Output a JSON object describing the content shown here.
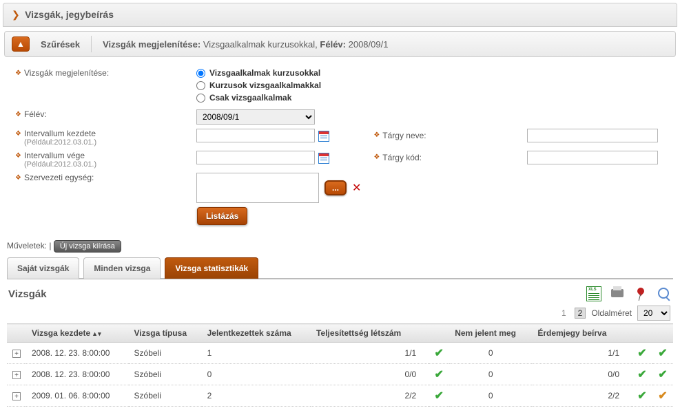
{
  "header": {
    "title": "Vizsgák, jegybeírás"
  },
  "filterBar": {
    "label": "Szűrések",
    "summary_prefix": "Vizsgák megjelenítése:",
    "summary_value": "Vizsgaalkalmak kurzusokkal,",
    "summary_term_label": "Félév:",
    "summary_term_value": "2008/09/1"
  },
  "filters": {
    "display_label": "Vizsgák megjelenítése:",
    "display_options": {
      "opt1": "Vizsgaalkalmak kurzusokkal",
      "opt2": "Kurzusok vizsgaalkalmakkal",
      "opt3": "Csak vizsgaalkalmak"
    },
    "felev_label": "Félév:",
    "felev_value": "2008/09/1",
    "int_start_label": "Intervallum kezdete",
    "int_start_hint": "(Például:2012.03.01.)",
    "int_end_label": "Intervallum vége",
    "int_end_hint": "(Például:2012.03.01.)",
    "targy_neve_label": "Tárgy neve:",
    "targy_kod_label": "Tárgy kód:",
    "szervezet_label": "Szervezeti egység:",
    "list_button": "Listázás",
    "browse_button": "..."
  },
  "operations": {
    "label": "Műveletek:",
    "new_exam": "Új vizsga kiírása"
  },
  "tabs": {
    "own": "Saját vizsgák",
    "all": "Minden vizsga",
    "stats": "Vizsga statisztikák"
  },
  "grid": {
    "title": "Vizsgák",
    "pager": {
      "page1": "1",
      "page2": "2",
      "size_label": "Oldalméret",
      "size_value": "20"
    },
    "cols": {
      "start": "Vizsga kezdete",
      "type": "Vizsga típusa",
      "applicants": "Jelentkezettek száma",
      "fulfilled": "Teljesítettség létszám",
      "noshow": "Nem jelent meg",
      "grade": "Érdemjegy beírva"
    },
    "rows": [
      {
        "start": "2008. 12. 23. 8:00:00",
        "type": "Szóbeli",
        "applicants": "1",
        "fulfilled": "1/1",
        "fulfilled_ok": "green",
        "noshow": "0",
        "grade": "1/1",
        "grade_ok": "green",
        "row_ok": "green"
      },
      {
        "start": "2008. 12. 23. 8:00:00",
        "type": "Szóbeli",
        "applicants": "0",
        "fulfilled": "0/0",
        "fulfilled_ok": "green",
        "noshow": "0",
        "grade": "0/0",
        "grade_ok": "green",
        "row_ok": "green"
      },
      {
        "start": "2009. 01. 06. 8:00:00",
        "type": "Szóbeli",
        "applicants": "2",
        "fulfilled": "2/2",
        "fulfilled_ok": "green",
        "noshow": "0",
        "grade": "2/2",
        "grade_ok": "green",
        "row_ok": "orange"
      }
    ]
  }
}
